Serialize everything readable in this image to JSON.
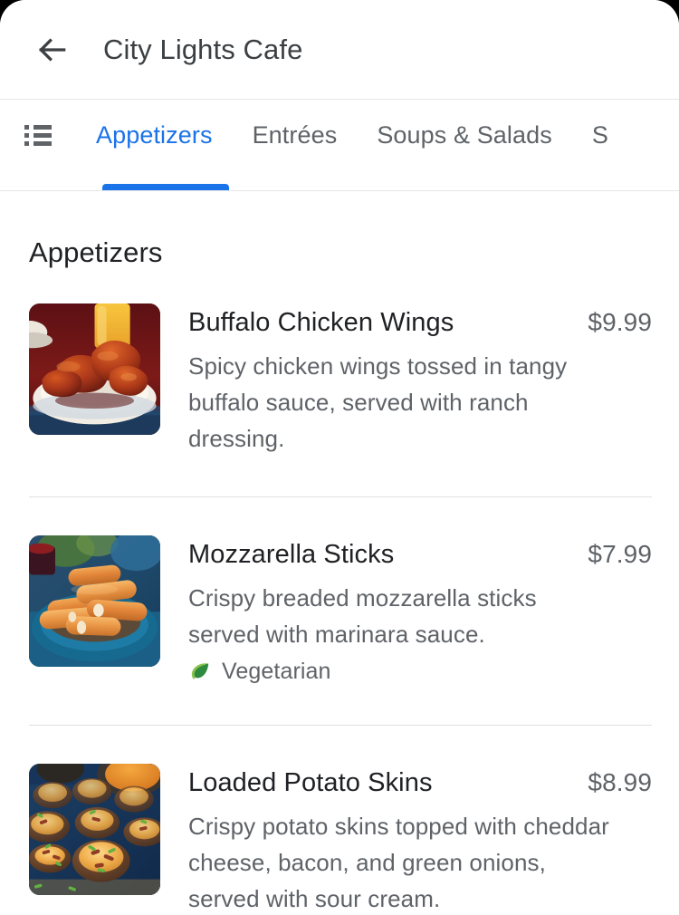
{
  "app": {
    "title": "City Lights Cafe",
    "back_icon": "arrow-left-icon",
    "accent_color": "#1a73e8",
    "title_color": "#3c4043"
  },
  "tabs": {
    "list_icon": "list-icon",
    "active_index": 0,
    "items": [
      {
        "label": "Appetizers",
        "active": true
      },
      {
        "label": "Entrées",
        "active": false
      },
      {
        "label": "Soups & Salads",
        "active": false
      },
      {
        "label": "S",
        "active": false
      }
    ]
  },
  "section": {
    "title": "Appetizers"
  },
  "menu_items": [
    {
      "name": "Buffalo Chicken Wings",
      "price": "$9.99",
      "description": "Spicy chicken wings tossed in tangy buffalo sauce, served with ranch dressing.",
      "image_alt": "buffalo-chicken-wings-photo",
      "badges": []
    },
    {
      "name": "Mozzarella Sticks",
      "price": "$7.99",
      "description": "Crispy breaded mozzarella sticks served with marinara sauce.",
      "image_alt": "mozzarella-sticks-photo",
      "badges": [
        {
          "label": "Vegetarian",
          "icon": "leaf-icon",
          "color": "#34a853"
        }
      ]
    },
    {
      "name": "Loaded Potato Skins",
      "price": "$8.99",
      "description": "Crispy potato skins topped with cheddar cheese, bacon, and green onions, served with sour cream.",
      "image_alt": "loaded-potato-skins-photo",
      "badges": []
    }
  ]
}
